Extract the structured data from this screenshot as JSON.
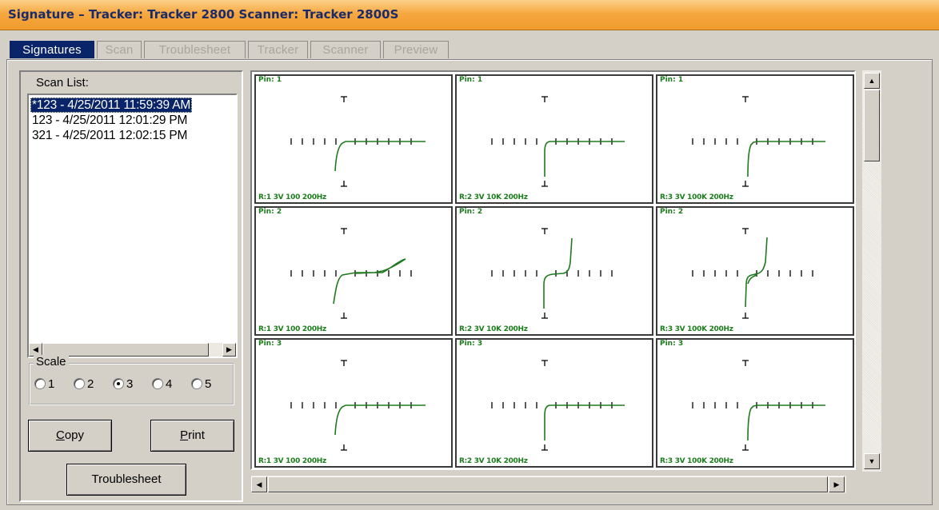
{
  "window": {
    "title": "Signature – Tracker: Tracker 2800  Scanner: Tracker 2800S"
  },
  "tabs": [
    {
      "label": "Signatures",
      "active": true
    },
    {
      "label": "Scan",
      "active": false
    },
    {
      "label": "Troublesheet",
      "active": false
    },
    {
      "label": "Tracker",
      "active": false
    },
    {
      "label": "Scanner",
      "active": false
    },
    {
      "label": "Preview",
      "active": false
    }
  ],
  "scan_list": {
    "label": "Scan List:",
    "items": [
      {
        "text": "*123 - 4/25/2011 11:59:39 AM",
        "selected": true
      },
      {
        "text": "123 - 4/25/2011 12:01:29 PM",
        "selected": false
      },
      {
        "text": "321 - 4/25/2011 12:02:15 PM",
        "selected": false
      }
    ]
  },
  "scale": {
    "label": "Scale",
    "options": [
      "1",
      "2",
      "3",
      "4",
      "5"
    ],
    "selected": "3"
  },
  "buttons": {
    "copy": {
      "prefix": "",
      "accel": "C",
      "rest": "opy"
    },
    "print": {
      "prefix": "",
      "accel": "P",
      "rest": "rint"
    },
    "troublesheet": "Troublesheet"
  },
  "signatures": [
    {
      "pin": "Pin: 1",
      "range": "R:1 3V 100 200Hz",
      "curve": "knee_soft"
    },
    {
      "pin": "Pin: 1",
      "range": "R:2 3V 10K 200Hz",
      "curve": "knee_sharp"
    },
    {
      "pin": "Pin: 1",
      "range": "R:3 3V 100K 200Hz",
      "curve": "knee_sharp2"
    },
    {
      "pin": "Pin: 2",
      "range": "R:1 3V 100 200Hz",
      "curve": "loop"
    },
    {
      "pin": "Pin: 2",
      "range": "R:2 3V 10K 200Hz",
      "curve": "zener"
    },
    {
      "pin": "Pin: 2",
      "range": "R:3 3V 100K 200Hz",
      "curve": "zener2"
    },
    {
      "pin": "Pin: 3",
      "range": "R:1 3V 100 200Hz",
      "curve": "knee_soft"
    },
    {
      "pin": "Pin: 3",
      "range": "R:2 3V 10K 200Hz",
      "curve": "knee_sharp"
    },
    {
      "pin": "Pin: 3",
      "range": "R:3 3V 100K 200Hz",
      "curve": "knee_sharp2"
    }
  ],
  "colors": {
    "trace": "#1f7a1f",
    "tab_active": "#0a246a",
    "title_text": "#1a2b6b"
  }
}
